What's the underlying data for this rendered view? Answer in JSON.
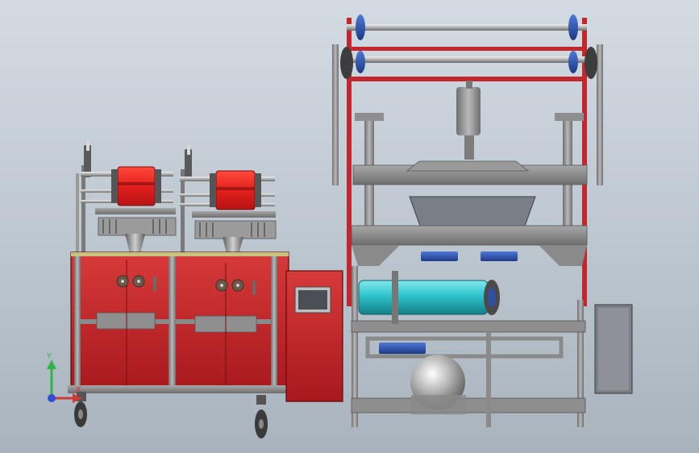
{
  "view": {
    "background_top": "#d3dbe2",
    "background_bottom": "#a9b3bd"
  },
  "model": {
    "frame_color": "#c1272d",
    "steel_color": "#8e8e8e",
    "roller_color": "#30c4cc",
    "motor_color": "#2f4fa0"
  },
  "triad": {
    "y_label": "Y",
    "x_label": "X",
    "y_color": "#2fb24a",
    "x_color": "#d23a3a",
    "z_color": "#2b4fd8"
  }
}
